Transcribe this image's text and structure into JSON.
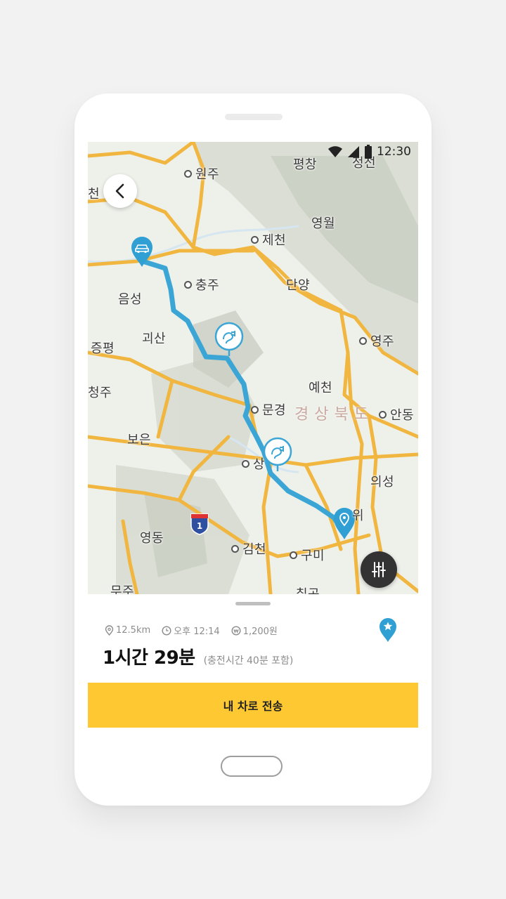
{
  "status_bar": {
    "time": "12:30"
  },
  "map": {
    "labels": {
      "wonju": "원주",
      "pyeongchang": "평창",
      "jeongseon": "정선",
      "cheon": "천",
      "jecheon": "제천",
      "yeongwol": "영월",
      "chungju": "충주",
      "danyang": "단양",
      "eumseong": "음성",
      "goesan": "괴산",
      "jeungpyeong": "증평",
      "yeongju": "영주",
      "cheongju": "청주",
      "yecheon": "예천",
      "mungyeong": "문경",
      "andong": "안동",
      "boeun": "보은",
      "sangju": "상",
      "uiseong": "의성",
      "yeongdong": "영동",
      "gimcheon": "김천",
      "gumi": "구미",
      "muju": "무주",
      "chilgok": "칠곡",
      "region": "경상북도",
      "wi": "위",
      "highway_no": "1"
    }
  },
  "trip": {
    "distance": "12.5km",
    "arrival": "오후 12:14",
    "cost": "1,200원",
    "duration": "1시간 29분",
    "duration_note": "(충전시간 40분 포함)"
  },
  "actions": {
    "send_label": "내 차로 전송"
  },
  "colors": {
    "accent": "#fdc832",
    "route": "#3ba6d6",
    "pin": "#2f9fd4"
  }
}
